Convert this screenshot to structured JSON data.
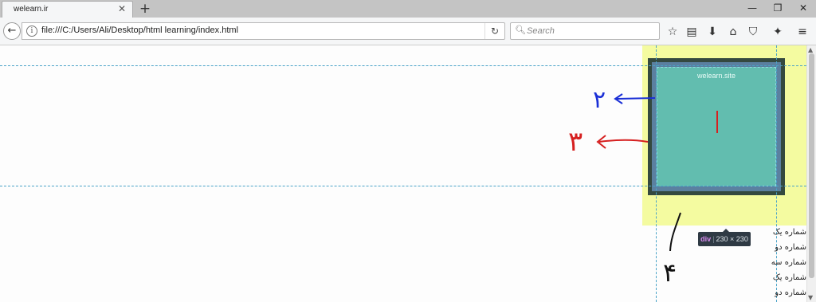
{
  "browser": {
    "tab": {
      "title": "welearn.ir",
      "close_icon": "close-icon"
    },
    "new_tab_icon": "plus-icon",
    "window_controls": [
      "minimize-icon",
      "restore-icon",
      "close-icon"
    ],
    "url": "file:///C:/Users/Ali/Desktop/html learning/index.html",
    "search": {
      "placeholder": "Search"
    },
    "toolbar_icons": [
      "star-icon",
      "reading-list-icon",
      "download-icon",
      "home-icon",
      "pocket-icon",
      "extension-icon",
      "menu-icon"
    ]
  },
  "page": {
    "box_text": "welearn.site",
    "tooltip": {
      "tag": "div",
      "size": "230 × 230"
    },
    "list_items": [
      "شماره یک",
      "شماره دو",
      "شماره سه",
      "شماره یک",
      "شماره دو"
    ],
    "annotations": [
      "۲",
      "۳",
      "۴"
    ]
  },
  "colors": {
    "margin": "#f4fba0",
    "border": "#34493f",
    "padding": "#5b80a0",
    "content": "#62bdaf",
    "guide": "#4aa3c8"
  }
}
